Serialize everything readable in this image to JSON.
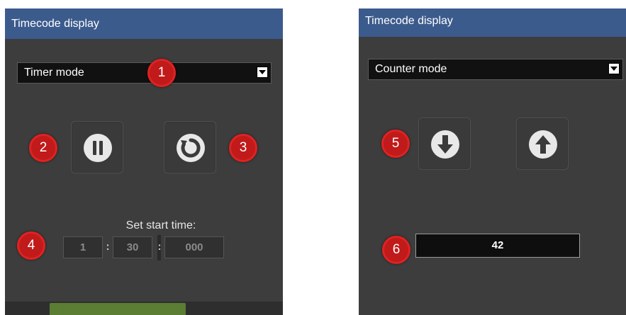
{
  "timer_panel": {
    "title": "Timecode display",
    "mode": "Timer mode",
    "start_time_label": "Set start time:",
    "start_time": {
      "hours": "1",
      "minutes": "30",
      "milliseconds": "000"
    },
    "separator": ":",
    "pause_icon": "pause-icon",
    "reset_icon": "reset-icon"
  },
  "counter_panel": {
    "title": "Timecode display",
    "mode": "Counter mode",
    "counter_value": "42",
    "decrement_icon": "arrow-down-icon",
    "increment_icon": "arrow-up-icon"
  },
  "callouts": [
    "1",
    "2",
    "3",
    "4",
    "5",
    "6"
  ],
  "colors": {
    "title_bar": "#3c5b8d",
    "panel_bg": "#3d3d3d",
    "callout_red": "#c11a1a",
    "start_button_green": "#5b7d34"
  }
}
